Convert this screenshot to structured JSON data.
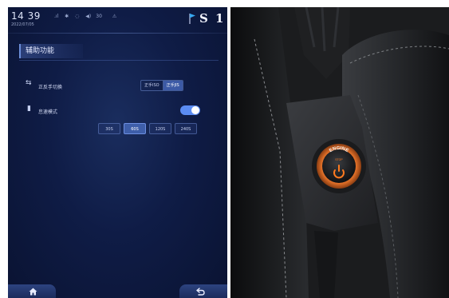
{
  "status_bar": {
    "time": "14 39",
    "date": "2022/07/05",
    "icons": [
      "signal-icon",
      "bluetooth-icon",
      "wifi-icon",
      "volume-icon",
      "warning-icon"
    ],
    "volume": "30",
    "gear": "S 1"
  },
  "page": {
    "title": "辅助功能"
  },
  "rows": {
    "reverse_switch": {
      "label": "正反手切换",
      "options": [
        "正手ISO",
        "正手JIS"
      ],
      "selected": "正手JIS"
    },
    "standby_mode": {
      "label": "怠速模式",
      "enabled": true,
      "times": [
        "30S",
        "60S",
        "120S",
        "240S"
      ],
      "selected_time": "60S"
    }
  },
  "nav": {
    "home": "home-icon",
    "back": "back-icon"
  },
  "photo": {
    "button_top_text": "ENGINE",
    "button_bottom_text": "STOP",
    "colors": {
      "ring": "#e8742a",
      "accent": "#ff7a1f",
      "seat": "#141517"
    }
  },
  "colors": {
    "accent": "#3e5ea9",
    "toggle": "#5b8cf2",
    "background": "#0f1c46"
  }
}
